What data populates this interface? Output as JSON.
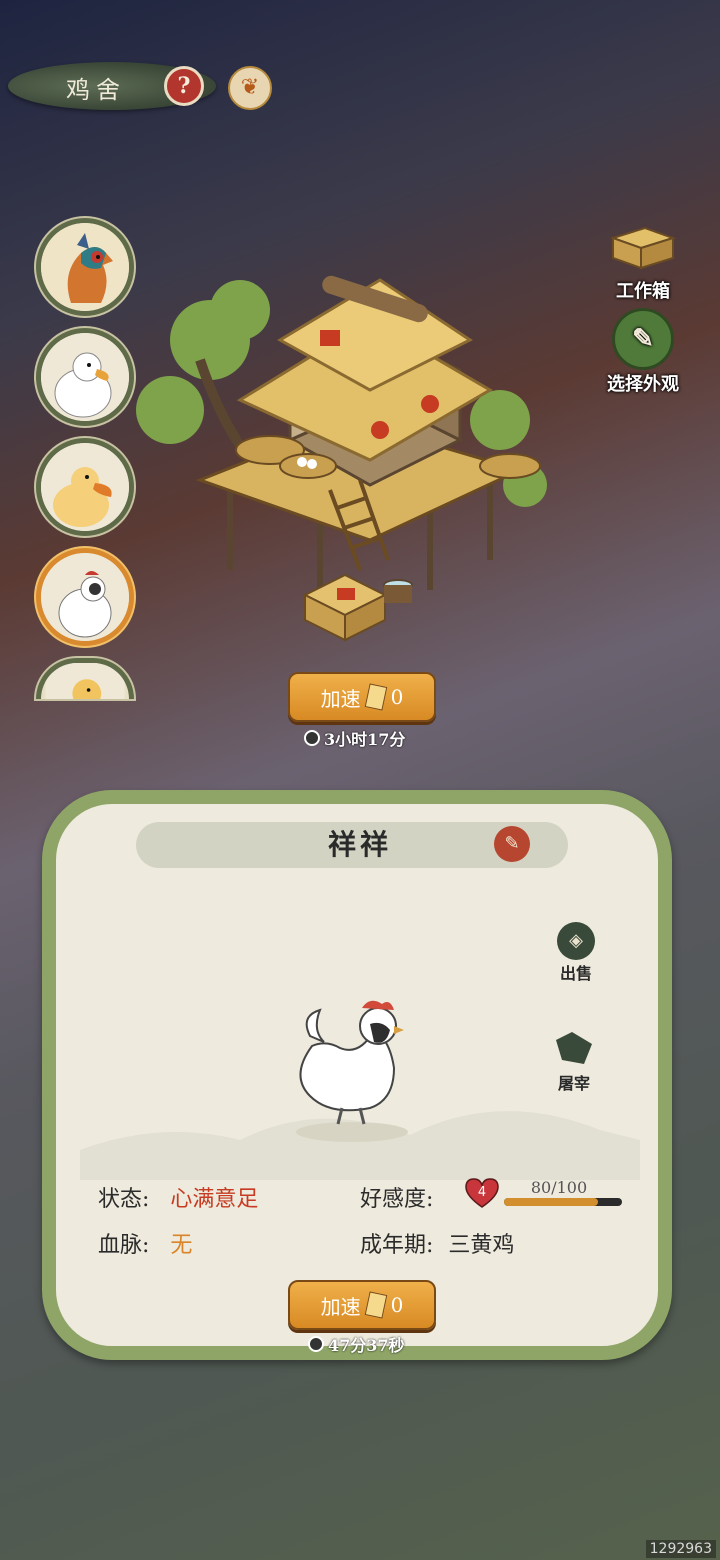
{
  "header": {
    "title": "鸡舍",
    "help_icon": "question-icon",
    "crest_icon": "phoenix-icon"
  },
  "avatars": [
    {
      "name": "pheasant",
      "selected": false
    },
    {
      "name": "white-duck",
      "selected": false
    },
    {
      "name": "yellow-duck",
      "selected": false
    },
    {
      "name": "white-chicken",
      "selected": true
    },
    {
      "name": "yellow-bird",
      "selected": false
    }
  ],
  "right_menu": {
    "workbox_label": "工作箱",
    "appearance_label": "选择外观"
  },
  "building": {
    "speed_label": "加速",
    "speed_count": "0",
    "timer": "3小时17分"
  },
  "panel": {
    "name": "祥祥",
    "sell_label": "出售",
    "slaughter_label": "屠宰",
    "status_label": "状态:",
    "status_value": "心满意足",
    "bloodline_label": "血脉:",
    "bloodline_value": "无",
    "affection_label": "好感度:",
    "affection_level": "4",
    "affection_value": "80/100",
    "affection_fraction": 0.8,
    "stage_label": "成年期:",
    "stage_value": "三黄鸡",
    "speed_label": "加速",
    "speed_count": "0",
    "timer": "47分37秒"
  },
  "watermark": "1292963",
  "colors": {
    "accent_orange": "#d98a2e",
    "panel_border": "#8ea567",
    "status_red": "#c63b22"
  }
}
